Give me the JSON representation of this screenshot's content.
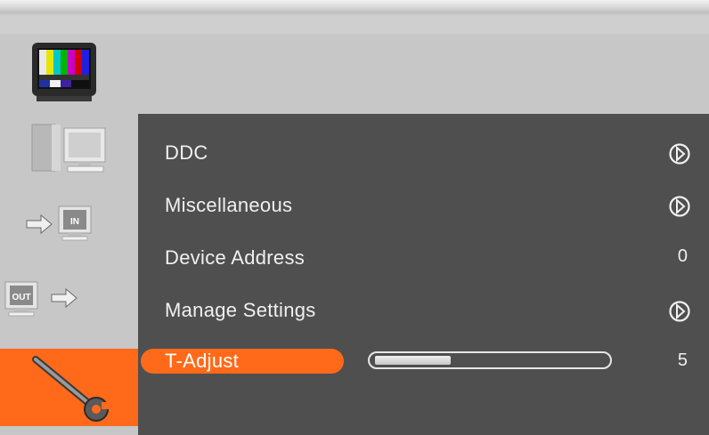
{
  "menu": {
    "items": [
      {
        "label": "DDC",
        "type": "submenu"
      },
      {
        "label": "Miscellaneous",
        "type": "submenu"
      },
      {
        "label": "Device Address",
        "type": "value",
        "value": "0"
      },
      {
        "label": "Manage Settings",
        "type": "submenu"
      }
    ],
    "t_adjust": {
      "label": "T-Adjust",
      "value": "5",
      "level_fraction": 0.33
    }
  },
  "sidebar": {
    "items": [
      {
        "name": "picture",
        "icon": "tv-color-bars-icon"
      },
      {
        "name": "computer",
        "icon": "computer-icon"
      },
      {
        "name": "input",
        "icon": "input-arrow-icon",
        "badge": "IN"
      },
      {
        "name": "output",
        "icon": "output-arrow-icon",
        "badge": "OUT"
      },
      {
        "name": "tools",
        "icon": "wrench-icon",
        "active": true
      }
    ]
  },
  "colors": {
    "accent": "#ff6a1a",
    "panel": "#4f4f4f",
    "sidebar": "#c7c7c7",
    "text": "#f0f0f0"
  }
}
